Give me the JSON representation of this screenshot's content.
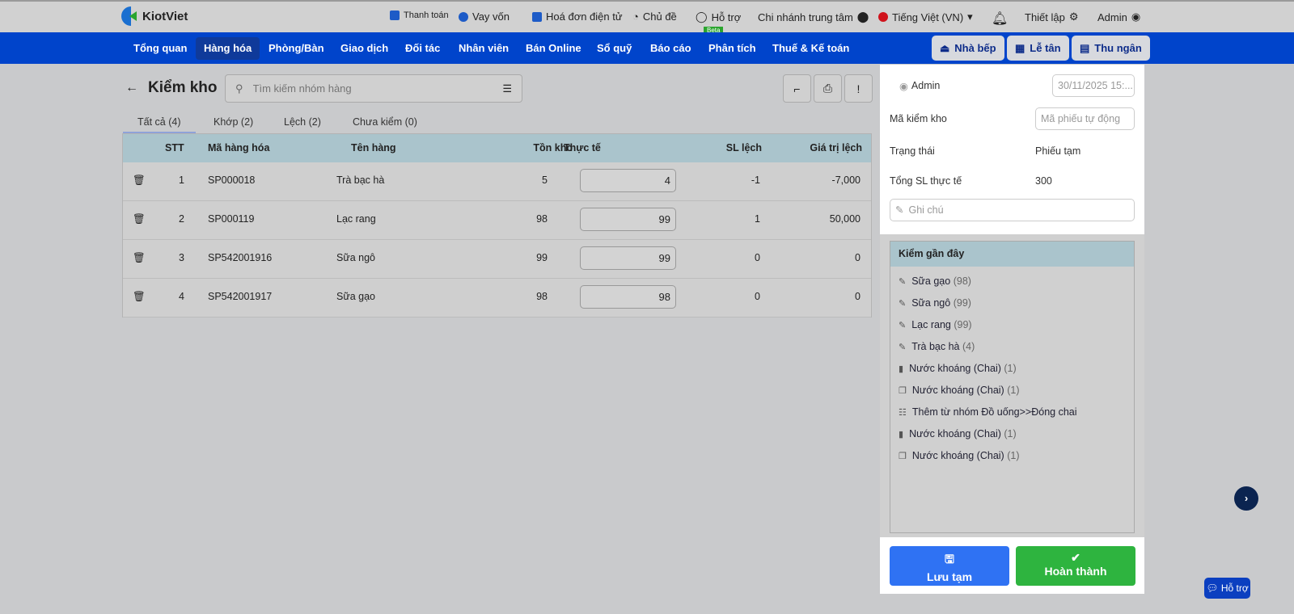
{
  "header": {
    "brand": "KiotViet",
    "links": [
      {
        "label": "Thanh toán",
        "icon": "payment-icon"
      },
      {
        "label": "Vay vốn",
        "icon": "money-bag-icon"
      },
      {
        "label": "Hoá đơn điện tử",
        "icon": "invoice-icon"
      },
      {
        "label": "Chủ đề",
        "icon": "palette-icon"
      },
      {
        "label": "Hỗ trợ",
        "icon": "chat-icon",
        "badge": "Beta"
      }
    ],
    "branch": "Chi nhánh trung tâm",
    "language": "Tiếng Việt (VN)",
    "settings": "Thiết lập",
    "user": "Admin"
  },
  "nav": {
    "items": [
      "Tổng quan",
      "Hàng hóa",
      "Phòng/Bàn",
      "Giao dịch",
      "Đối tác",
      "Nhân viên",
      "Bán Online",
      "Sổ quỹ",
      "Báo cáo",
      "Phân tích",
      "Thuế & Kế toán"
    ],
    "active": "Hàng hóa",
    "buttons": [
      "Nhà bếp",
      "Lễ tân",
      "Thu ngân"
    ]
  },
  "page": {
    "title": "Kiểm kho",
    "search_placeholder": "Tìm kiếm nhóm hàng"
  },
  "tabs": [
    "Tất cả (4)",
    "Khớp (2)",
    "Lệch (2)",
    "Chưa kiểm (0)"
  ],
  "table": {
    "headers": [
      "STT",
      "Mã hàng hóa",
      "Tên hàng",
      "Tồn kho",
      "Thực tế",
      "SL lệch",
      "Giá trị lệch"
    ],
    "rows": [
      {
        "stt": "1",
        "code": "SP000018",
        "name": "Trà bạc hà",
        "stock": "5",
        "actual": "4",
        "diff": "-1",
        "value": "-7,000"
      },
      {
        "stt": "2",
        "code": "SP000119",
        "name": "Lạc rang",
        "stock": "98",
        "actual": "99",
        "diff": "1",
        "value": "50,000"
      },
      {
        "stt": "3",
        "code": "SP542001916",
        "name": "Sữa ngô",
        "stock": "99",
        "actual": "99",
        "diff": "0",
        "value": "0"
      },
      {
        "stt": "4",
        "code": "SP542001917",
        "name": "Sữa gạo",
        "stock": "98",
        "actual": "98",
        "diff": "0",
        "value": "0"
      }
    ]
  },
  "panel": {
    "user": "Admin",
    "datetime": "30/11/2025 15:...",
    "code_label": "Mã kiểm kho",
    "code_placeholder": "Mã phiếu tự động",
    "status_label": "Trạng thái",
    "status": "Phiếu tạm",
    "total_label": "Tổng SL thực tế",
    "total": "300",
    "note_placeholder": "Ghi chú",
    "recent_title": "Kiểm gần đây",
    "recent": [
      {
        "icon": "pencil-icon",
        "text": "Sữa gạo",
        "count": "(98)"
      },
      {
        "icon": "pencil-icon",
        "text": "Sữa ngô",
        "count": "(99)"
      },
      {
        "icon": "pencil-icon",
        "text": "Lạc rang",
        "count": "(99)"
      },
      {
        "icon": "pencil-icon",
        "text": "Trà bạc hà",
        "count": "(4)"
      },
      {
        "icon": "trash-icon",
        "text": "Nước khoáng (Chai)",
        "count": "(1)"
      },
      {
        "icon": "copy-icon",
        "text": "Nước khoáng (Chai)",
        "count": "(1)"
      },
      {
        "icon": "list-icon",
        "text": "Thêm từ nhóm Đồ uống>>Đóng chai",
        "count": ""
      },
      {
        "icon": "trash-icon",
        "text": "Nước khoáng (Chai)",
        "count": "(1)"
      },
      {
        "icon": "copy-icon",
        "text": "Nước khoáng (Chai)",
        "count": "(1)"
      }
    ],
    "save_label": "Lưu tạm",
    "complete_label": "Hoàn thành"
  },
  "help_label": "Hỗ trợ",
  "colors": {
    "nav": "#0044cb",
    "save": "#2f72f3",
    "complete": "#2eb43f",
    "table_header": "#aac4cc"
  }
}
